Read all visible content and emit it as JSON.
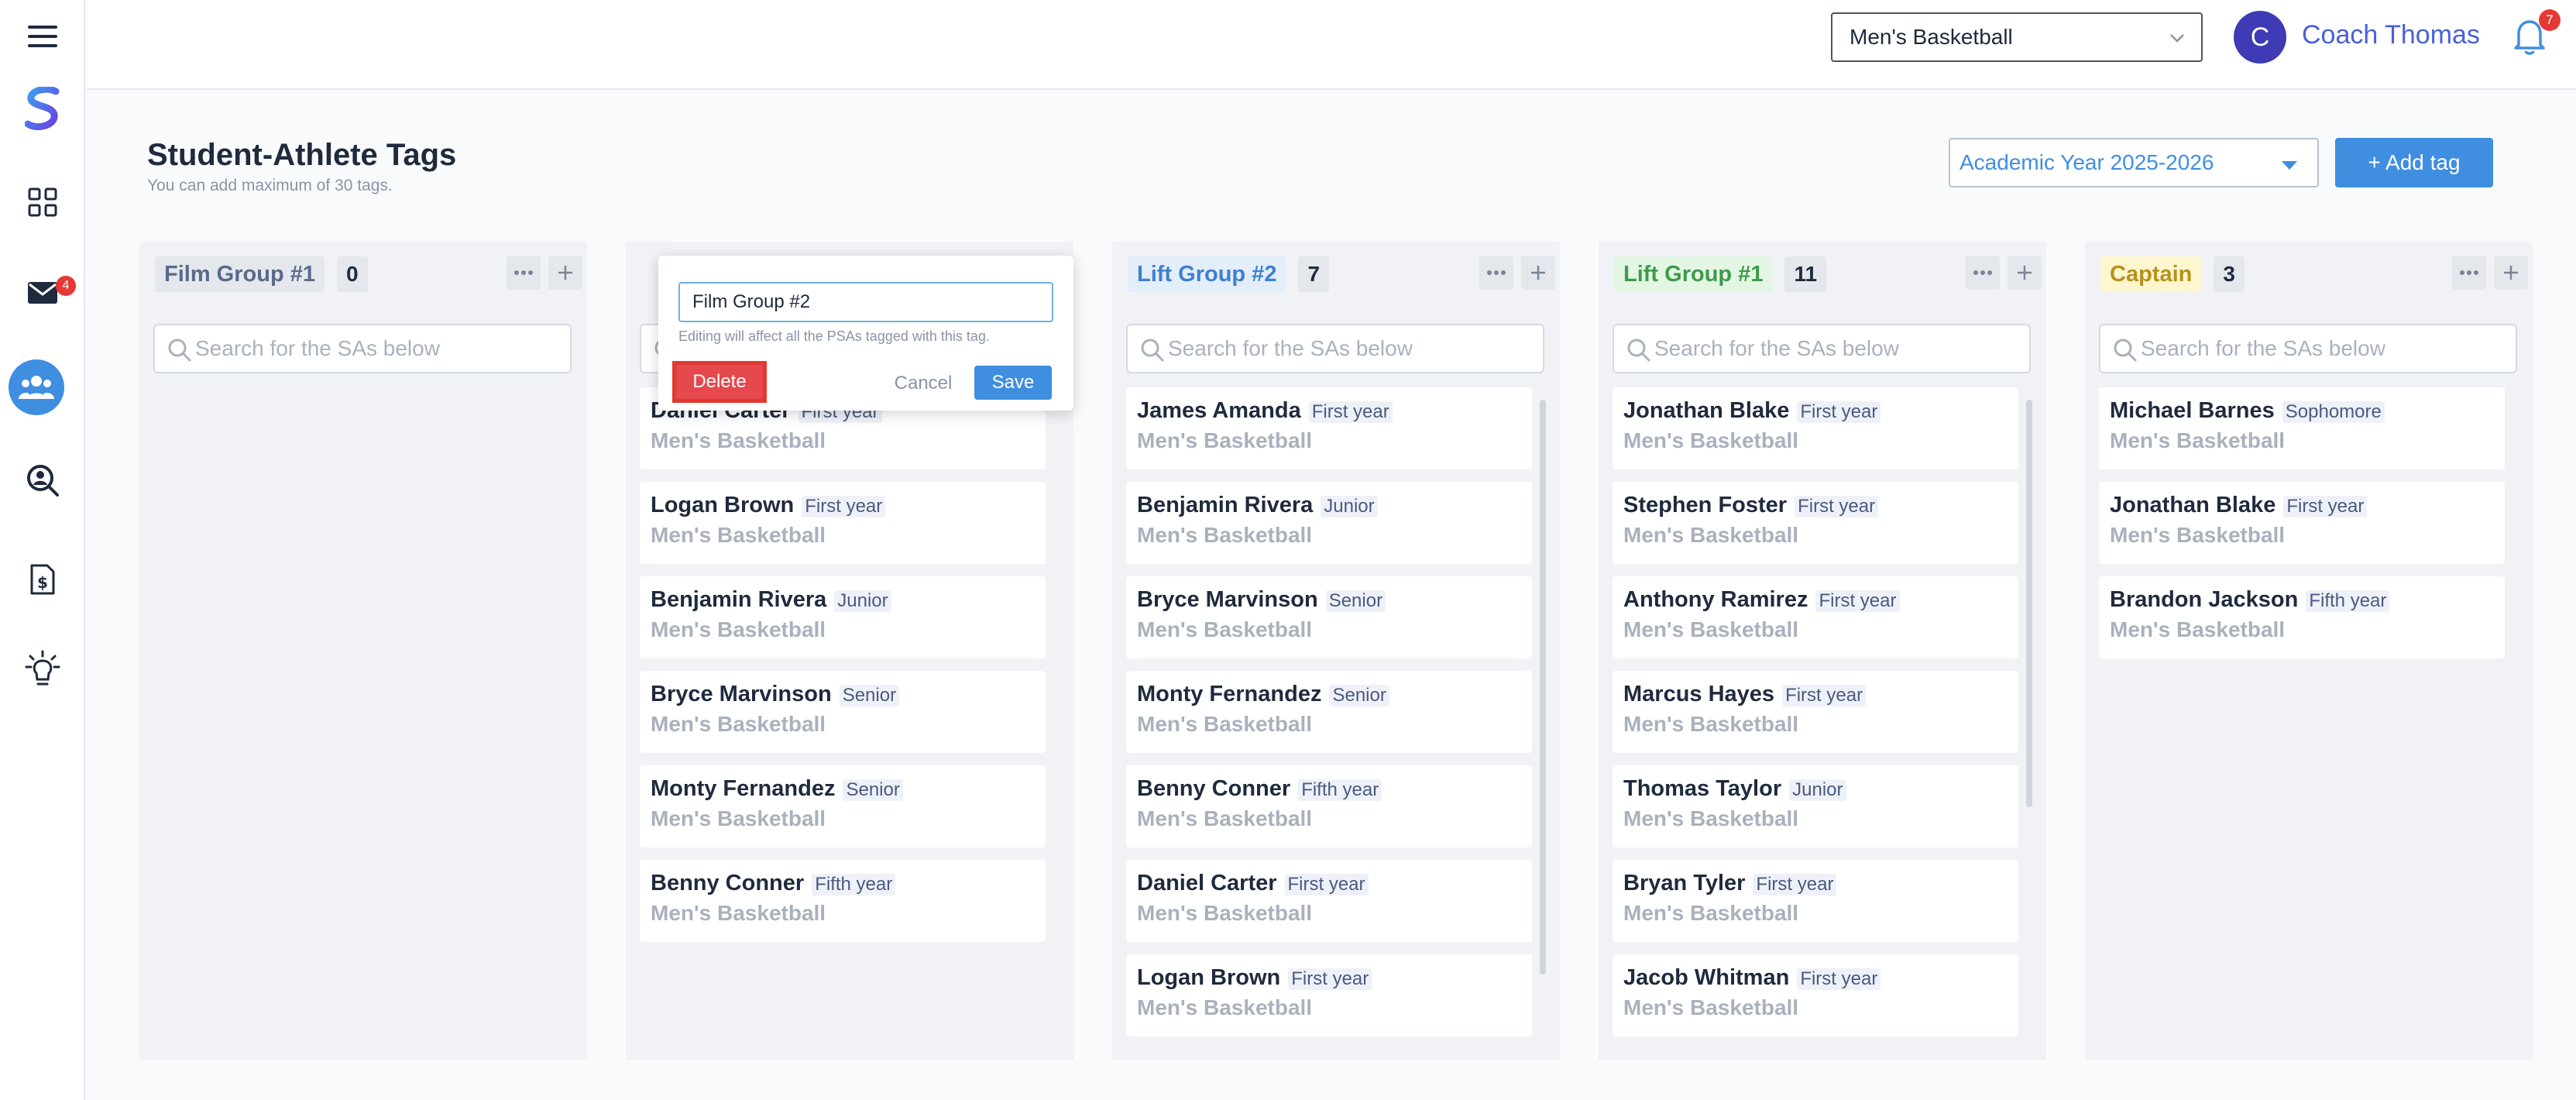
{
  "topbar": {
    "sport_selector": "Men's Basketball",
    "avatar_initial": "C",
    "user_name": "Coach Thomas",
    "notification_count": "7"
  },
  "sidebar": {
    "items": [
      {
        "icon": "menu-icon"
      },
      {
        "icon": "logo-icon"
      },
      {
        "icon": "dashboard-grid-icon"
      },
      {
        "icon": "mail-icon",
        "badge": "4"
      },
      {
        "icon": "people-group-icon",
        "active": true
      },
      {
        "icon": "search-person-icon"
      },
      {
        "icon": "document-dollar-icon"
      },
      {
        "icon": "lightbulb-icon"
      }
    ]
  },
  "page": {
    "title": "Student-Athlete Tags",
    "subtitle": "You can add maximum of 30 tags.",
    "academic_year": "Academic Year 2025-2026",
    "add_tag_label": "+ Add tag"
  },
  "search_placeholder": "Search for the SAs below",
  "columns": [
    {
      "tag": "Film Group #1",
      "count": "0",
      "tag_bg": "#e4e7ec",
      "tag_color": "#5a6a8a",
      "cards": []
    },
    {
      "tag": "",
      "count": "",
      "tag_bg": "#e4e7ec",
      "tag_color": "#5a6a8a",
      "cards": [
        {
          "name": "Daniel Carter",
          "year": "First year",
          "sport": "Men's Basketball"
        },
        {
          "name": "Logan Brown",
          "year": "First year",
          "sport": "Men's Basketball"
        },
        {
          "name": "Benjamin Rivera",
          "year": "Junior",
          "sport": "Men's Basketball"
        },
        {
          "name": "Bryce Marvinson",
          "year": "Senior",
          "sport": "Men's Basketball"
        },
        {
          "name": "Monty Fernandez",
          "year": "Senior",
          "sport": "Men's Basketball"
        },
        {
          "name": "Benny Conner",
          "year": "Fifth year",
          "sport": "Men's Basketball"
        }
      ]
    },
    {
      "tag": "Lift Group #2",
      "count": "7",
      "tag_bg": "#e3eefb",
      "tag_color": "#3f7fd0",
      "cards": [
        {
          "name": "James Amanda",
          "year": "First year",
          "sport": "Men's Basketball"
        },
        {
          "name": "Benjamin Rivera",
          "year": "Junior",
          "sport": "Men's Basketball"
        },
        {
          "name": "Bryce Marvinson",
          "year": "Senior",
          "sport": "Men's Basketball"
        },
        {
          "name": "Monty Fernandez",
          "year": "Senior",
          "sport": "Men's Basketball"
        },
        {
          "name": "Benny Conner",
          "year": "Fifth year",
          "sport": "Men's Basketball"
        },
        {
          "name": "Daniel Carter",
          "year": "First year",
          "sport": "Men's Basketball"
        },
        {
          "name": "Logan Brown",
          "year": "First year",
          "sport": "Men's Basketball"
        }
      ]
    },
    {
      "tag": "Lift Group #1",
      "count": "11",
      "tag_bg": "#e3f6e3",
      "tag_color": "#3e9a4a",
      "cards": [
        {
          "name": "Jonathan Blake",
          "year": "First year",
          "sport": "Men's Basketball"
        },
        {
          "name": "Stephen Foster",
          "year": "First year",
          "sport": "Men's Basketball"
        },
        {
          "name": "Anthony Ramirez",
          "year": "First year",
          "sport": "Men's Basketball"
        },
        {
          "name": "Marcus Hayes",
          "year": "First year",
          "sport": "Men's Basketball"
        },
        {
          "name": "Thomas Taylor",
          "year": "Junior",
          "sport": "Men's Basketball"
        },
        {
          "name": "Bryan Tyler",
          "year": "First year",
          "sport": "Men's Basketball"
        },
        {
          "name": "Jacob Whitman",
          "year": "First year",
          "sport": "Men's Basketball"
        }
      ]
    },
    {
      "tag": "Captain",
      "count": "3",
      "tag_bg": "#fdf6cf",
      "tag_color": "#b5921c",
      "cards": [
        {
          "name": "Michael Barnes",
          "year": "Sophomore",
          "sport": "Men's Basketball"
        },
        {
          "name": "Jonathan Blake",
          "year": "First year",
          "sport": "Men's Basketball"
        },
        {
          "name": "Brandon Jackson",
          "year": "Fifth year",
          "sport": "Men's Basketball"
        }
      ]
    }
  ],
  "edit_popup": {
    "input_value": "Film Group #2",
    "hint": "Editing will affect all the PSAs tagged with this tag.",
    "delete_label": "Delete",
    "cancel_label": "Cancel",
    "save_label": "Save"
  },
  "colors": {
    "accent": "#3f8ee0",
    "danger": "#e5484d",
    "badge": "#e53935"
  }
}
